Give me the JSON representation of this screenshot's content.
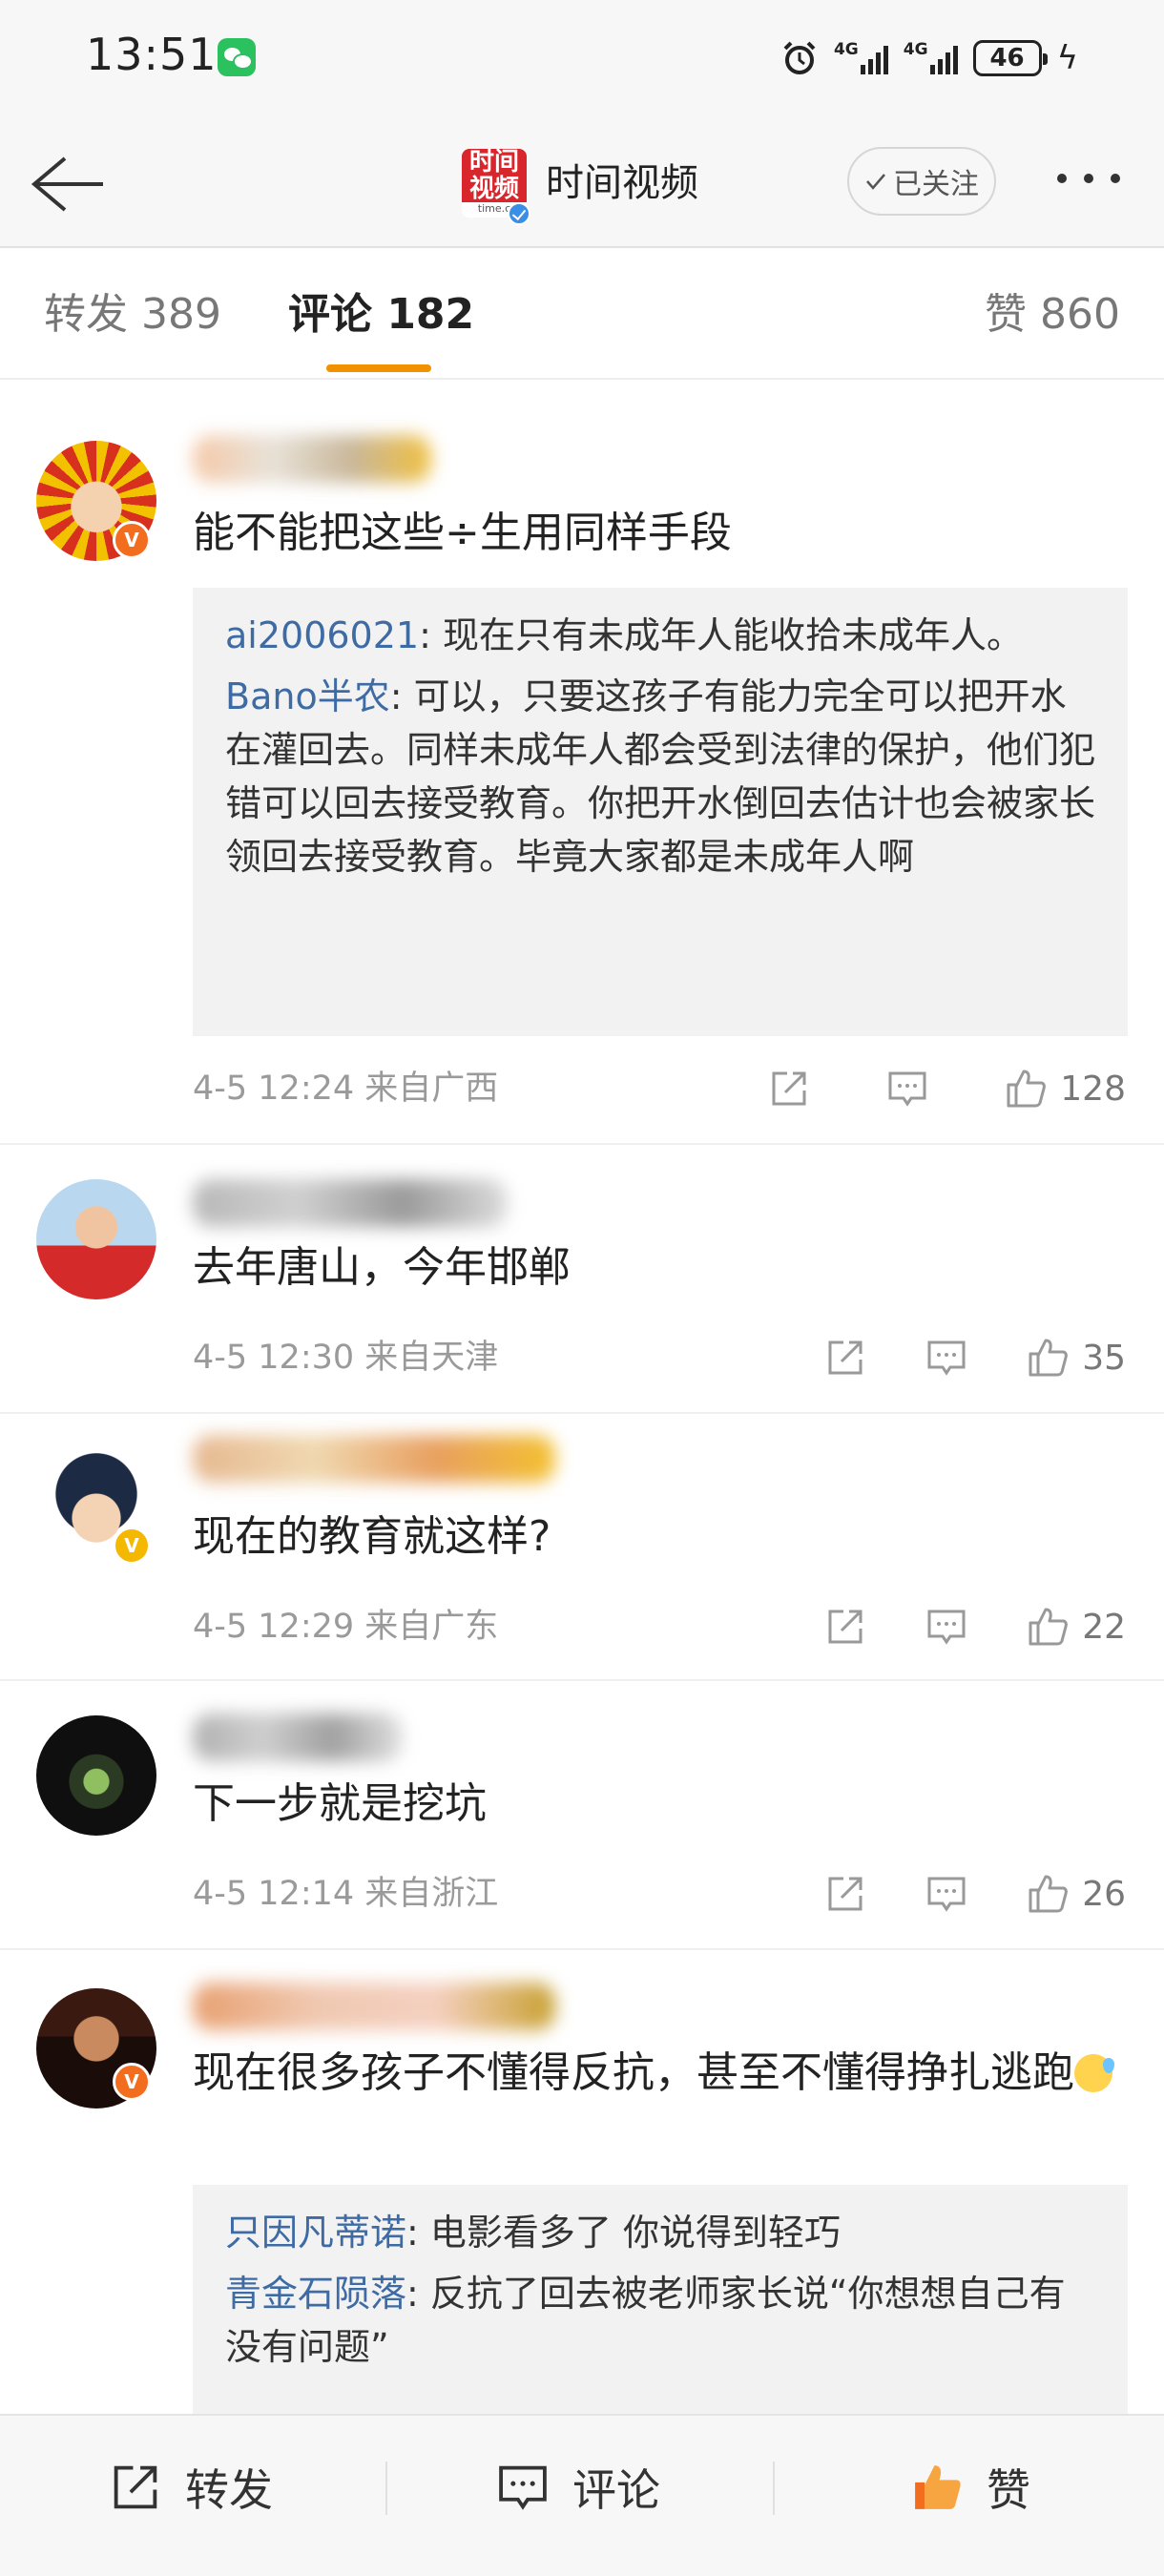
{
  "status_bar": {
    "time": "13:51",
    "network_1": "4G",
    "network_2": "4G",
    "battery": "46"
  },
  "header": {
    "account_name": "时间视频",
    "logo_text": "时间视频",
    "logo_url_fragment": "time.c",
    "follow_label": "已关注"
  },
  "tabs": {
    "repost": "转发 389",
    "comment": "评论 182",
    "like": "赞 860"
  },
  "comments": [
    {
      "text": "能不能把这些÷生用同样手段",
      "replies": [
        {
          "user": "ai2006021",
          "text": ": 现在只有未成年人能收拾未成年人。"
        },
        {
          "user": "Bano半农",
          "text": ": 可以，只要这孩子有能力完全可以把开水在灌回去。同样未成年人都会受到法律的保护，他们犯错可以回去接受教育。你把开水倒回去估计也会被家长领回去接受教育。毕竟大家都是未成年人啊"
        }
      ],
      "time": "4-5 12:24",
      "location": "来自广西",
      "likes": "128"
    },
    {
      "text": "去年唐山，今年邯郸",
      "time": "4-5 12:30",
      "location": "来自天津",
      "likes": "35"
    },
    {
      "text": "现在的教育就这样?",
      "time": "4-5 12:29",
      "location": "来自广东",
      "likes": "22"
    },
    {
      "text": "下一步就是挖坑",
      "time": "4-5 12:14",
      "location": "来自浙江",
      "likes": "26"
    },
    {
      "text": "现在很多孩子不懂得反抗，甚至不懂得挣扎逃跑",
      "replies": [
        {
          "user": "只因凡蒂诺",
          "text": ": 电影看多了 你说得到轻巧"
        },
        {
          "user": "青金石陨落",
          "text": ": 反抗了回去被老师家长说“你想想自己有没有问题”"
        }
      ]
    }
  ],
  "bottom_bar": {
    "repost": "转发",
    "comment": "评论",
    "like": "赞"
  },
  "colors": {
    "accent": "#f29100",
    "link": "#3e6ba3",
    "like_active": "#f26d1e"
  }
}
